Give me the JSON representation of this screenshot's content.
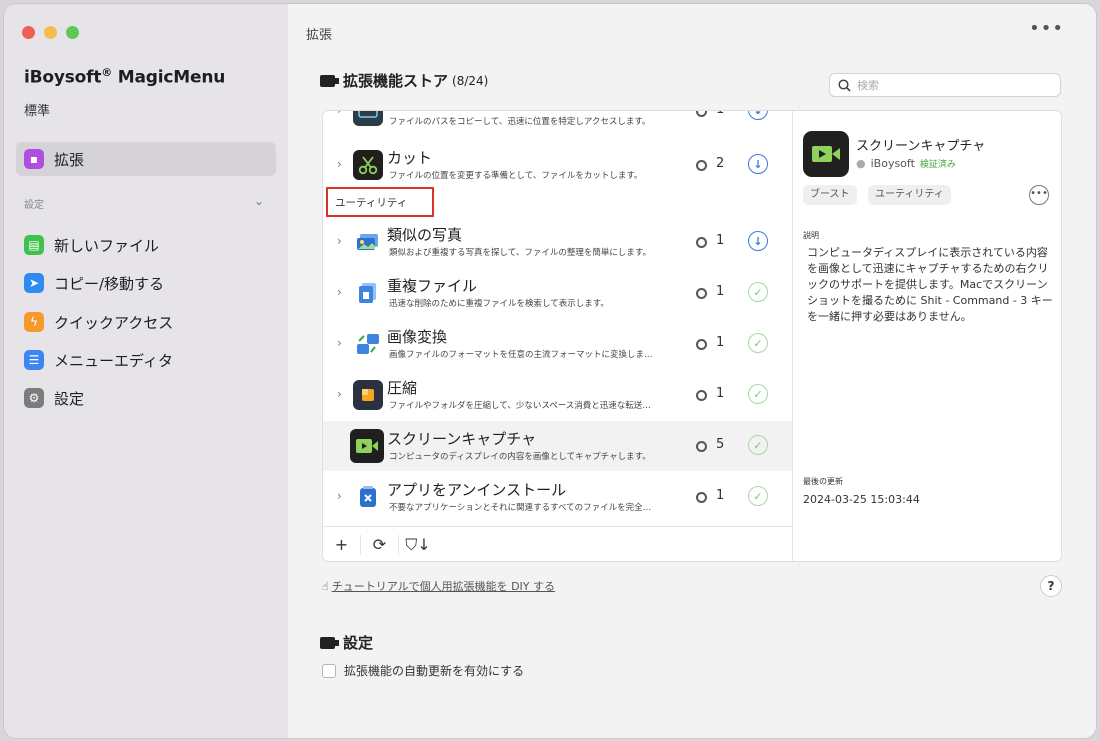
{
  "app": {
    "name": "iBoysoft",
    "reg": "®",
    "name_suffix": " MagicMenu",
    "edition": "標準"
  },
  "sidebar": {
    "active": {
      "label": "拡張",
      "icon": "extension-icon",
      "color": "#b04ee0"
    },
    "section_label": "設定",
    "items": [
      {
        "label": "新しいファイル",
        "icon": "new-file-icon",
        "color": "#3fc24d"
      },
      {
        "label": "コピー/移動する",
        "icon": "send-icon",
        "color": "#2e8cf0"
      },
      {
        "label": "クイックアクセス",
        "icon": "bolt-icon",
        "color": "#f59a2a"
      },
      {
        "label": "メニューエディタ",
        "icon": "list-icon",
        "color": "#3a86f3"
      },
      {
        "label": "設定",
        "icon": "gear-icon",
        "color": "#7c7c7c"
      }
    ]
  },
  "header": {
    "title": "拡張"
  },
  "store": {
    "title": "拡張機能ストア",
    "count": "(8/24)"
  },
  "search": {
    "placeholder": "検索"
  },
  "list": {
    "category_label": "ユーティリティ",
    "rows": [
      {
        "title": "",
        "desc": "ファイルのパスをコピーして、迅速に位置を特定しアクセスします。",
        "downloads": "1",
        "status": "download",
        "icon": "copy-path-icon"
      },
      {
        "title": "カット",
        "desc": "ファイルの位置を変更する準備として、ファイルをカットします。",
        "downloads": "2",
        "status": "download",
        "icon": "scissors-icon"
      },
      {
        "title": "類似の写真",
        "desc": "類似および重複する写真を探して、ファイルの整理を簡単にします。",
        "downloads": "1",
        "status": "download",
        "icon": "photo-icon"
      },
      {
        "title": "重複ファイル",
        "desc": "迅速な削除のために重複ファイルを検索して表示します。",
        "downloads": "1",
        "status": "installed",
        "icon": "duplicate-file-icon"
      },
      {
        "title": "画像変換",
        "desc": "画像ファイルのフォーマットを任意の主流フォーマットに変換しま…",
        "downloads": "1",
        "status": "installed",
        "icon": "image-convert-icon"
      },
      {
        "title": "圧縮",
        "desc": "ファイルやフォルダを圧縮して、少ないスペース消費と迅速な転送…",
        "downloads": "1",
        "status": "installed",
        "icon": "compress-icon"
      },
      {
        "title": "スクリーンキャプチャ",
        "desc": "コンピュータのディスプレイの内容を画像としてキャプチャします。",
        "downloads": "5",
        "status": "installed",
        "icon": "screen-capture-icon"
      },
      {
        "title": "アプリをアンインストール",
        "desc": "不要なアプリケーションとそれに関連するすべてのファイルを完全…",
        "downloads": "1",
        "status": "installed",
        "icon": "uninstall-icon"
      }
    ]
  },
  "toolbar": {
    "add": "+",
    "refresh": "⟳",
    "filter": "⛉↓"
  },
  "detail": {
    "title": "スクリーンキャプチャ",
    "author": "iBoysoft",
    "verified": "検証済み",
    "tags": [
      "ブースト",
      "ユーティリティ"
    ],
    "desc_label": "説明",
    "desc": "コンピュータディスプレイに表示されている内容を画像として迅速にキャプチャするための右クリックのサポートを提供します。Macでスクリーンショットを撮るために Shit - Command - 3 キーを一緒に押す必要はありません。",
    "updated_label": "最後の更新",
    "updated": "2024-03-25 15:03:44"
  },
  "tutorial": "チュートリアルで個人用拡張機能を DIY する",
  "settings": {
    "title": "設定",
    "auto_update": "拡張機能の自動更新を有効にする"
  },
  "colors": {
    "accent_blue": "#3a7bd5",
    "installed_green": "#7cc674",
    "highlight_red": "#d7322c"
  }
}
